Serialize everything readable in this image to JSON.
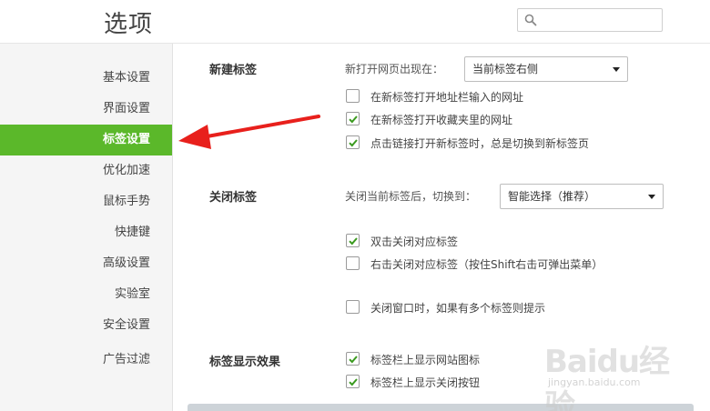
{
  "header": {
    "title": "选项",
    "search": {
      "placeholder": "",
      "value": ""
    }
  },
  "sidebar": {
    "items": [
      {
        "label": "基本设置",
        "active": false
      },
      {
        "label": "界面设置",
        "active": false
      },
      {
        "label": "标签设置",
        "active": true
      },
      {
        "label": "优化加速",
        "active": false
      },
      {
        "label": "鼠标手势",
        "active": false
      },
      {
        "label": "快捷键",
        "active": false
      },
      {
        "label": "高级设置",
        "active": false
      },
      {
        "label": "实验室",
        "active": false
      },
      {
        "label": "安全设置",
        "active": false
      },
      {
        "label": "广告过滤",
        "active": false
      }
    ]
  },
  "main": {
    "new_tab": {
      "title": "新建标签",
      "open_position_label": "新打开网页出现在：",
      "open_position_value": "当前标签右侧",
      "options": [
        {
          "label": "在新标签打开地址栏输入的网址",
          "checked": false
        },
        {
          "label": "在新标签打开收藏夹里的网址",
          "checked": true
        },
        {
          "label": "点击链接打开新标签时，总是切换到新标签页",
          "checked": true
        }
      ]
    },
    "close_tab": {
      "title": "关闭标签",
      "switch_label": "关闭当前标签后，切换到：",
      "switch_value": "智能选择（推荐）",
      "options": [
        {
          "label": "双击关闭对应标签",
          "checked": true
        },
        {
          "label": "右击关闭对应标签（按住Shift右击可弹出菜单）",
          "checked": false
        },
        {
          "label": "关闭窗口时，如果有多个标签则提示",
          "checked": false
        }
      ]
    },
    "tab_display": {
      "title": "标签显示效果",
      "options": [
        {
          "label": "标签栏上显示网站图标",
          "checked": true
        },
        {
          "label": "标签栏上显示关闭按钮",
          "checked": true
        }
      ]
    }
  },
  "watermark": {
    "text": "Baidu经验",
    "sub": "jingyan.baidu.com"
  },
  "colors": {
    "accent": "#5bb82a",
    "arrow": "#e8201c",
    "check": "#3a9a1e"
  }
}
